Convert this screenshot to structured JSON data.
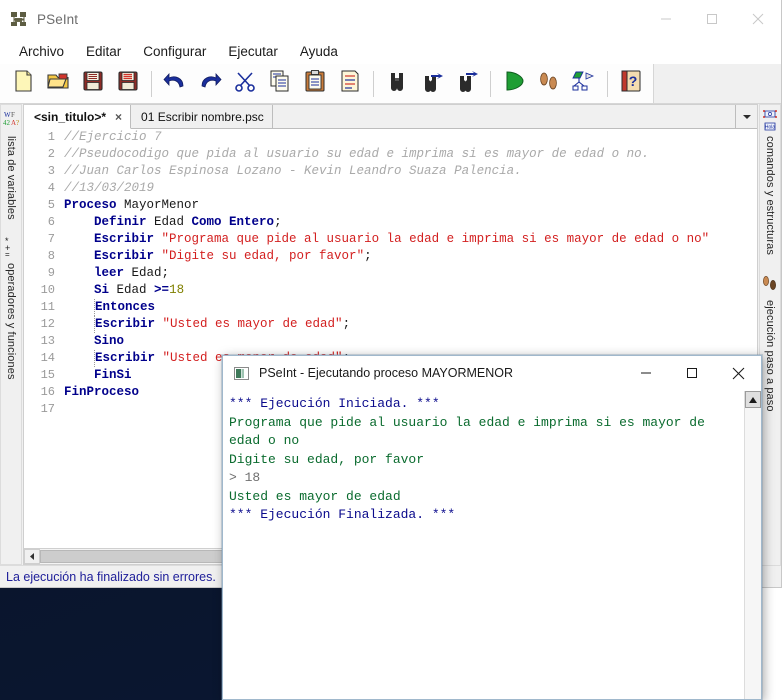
{
  "window": {
    "title": "PSeInt",
    "app_icon": "pseint-logo-icon",
    "controls": {
      "minimize": "minimize-icon",
      "maximize": "maximize-icon",
      "close": "close-icon"
    }
  },
  "menubar": {
    "items": [
      {
        "label": "Archivo"
      },
      {
        "label": "Editar"
      },
      {
        "label": "Configurar"
      },
      {
        "label": "Ejecutar"
      },
      {
        "label": "Ayuda"
      }
    ]
  },
  "toolbar": {
    "buttons": [
      {
        "name": "new-file-button",
        "icon": "new-document-icon",
        "title": "Nuevo"
      },
      {
        "name": "open-file-button",
        "icon": "open-folder-icon",
        "title": "Abrir"
      },
      {
        "name": "save-file-button",
        "icon": "save-diskette-icon",
        "title": "Guardar"
      },
      {
        "name": "save-as-button",
        "icon": "save-as-diskette-icon",
        "title": "Guardar como"
      },
      {
        "name": "undo-button",
        "icon": "undo-arrow-icon",
        "title": "Deshacer"
      },
      {
        "name": "redo-button",
        "icon": "redo-arrow-icon",
        "title": "Rehacer"
      },
      {
        "name": "cut-button",
        "icon": "scissors-icon",
        "title": "Cortar"
      },
      {
        "name": "copy-button",
        "icon": "copy-pages-icon",
        "title": "Copiar"
      },
      {
        "name": "paste-button",
        "icon": "clipboard-paste-icon",
        "title": "Pegar"
      },
      {
        "name": "select-all-button",
        "icon": "document-lines-icon",
        "title": "Seleccionar todo"
      },
      {
        "name": "find-button",
        "icon": "binoculars-icon",
        "title": "Buscar"
      },
      {
        "name": "find-next-button",
        "icon": "binoculars-next-icon",
        "title": "Buscar siguiente"
      },
      {
        "name": "replace-button",
        "icon": "binoculars-replace-icon",
        "title": "Reemplazar"
      },
      {
        "name": "run-button",
        "icon": "green-play-icon",
        "title": "Ejecutar"
      },
      {
        "name": "step-run-button",
        "icon": "footsteps-icon",
        "title": "Ejecución paso a paso"
      },
      {
        "name": "flowchart-button",
        "icon": "flowchart-icon",
        "title": "Dibujar diagrama de flujo"
      },
      {
        "name": "help-button",
        "icon": "help-book-icon",
        "title": "Ayuda"
      }
    ]
  },
  "rails": {
    "left": [
      {
        "label": "lista de variables",
        "icon": "variables-list-icon"
      },
      {
        "label": "operadores y funciones",
        "icon": "operators-functions-icon"
      }
    ],
    "right": [
      {
        "label": "comandos y estructuras",
        "icon": "commands-structures-icon"
      },
      {
        "label": "ejecución paso a paso",
        "icon": "step-execution-icon"
      }
    ]
  },
  "tabs": {
    "items": [
      {
        "label": "<sin_titulo>*",
        "active": true,
        "closable": true
      },
      {
        "label": "01 Escribir nombre.psc",
        "active": false,
        "closable": false
      }
    ],
    "close_glyph": "×",
    "dropdown_icon": "chevron-down-icon"
  },
  "editor": {
    "lines": [
      {
        "n": "1",
        "tokens": [
          {
            "t": "//Ejercicio 7",
            "c": "cmt"
          }
        ]
      },
      {
        "n": "2",
        "tokens": [
          {
            "t": "//Pseudocodigo que pida al usuario su edad e imprima si es mayor de edad o no.",
            "c": "cmt"
          }
        ]
      },
      {
        "n": "3",
        "tokens": [
          {
            "t": "//Juan Carlos Espinosa Lozano - Kevin Leandro Suaza Palencia.",
            "c": "cmt"
          }
        ]
      },
      {
        "n": "4",
        "tokens": [
          {
            "t": "//13/03/2019",
            "c": "cmt"
          }
        ]
      },
      {
        "n": "5",
        "tokens": [
          {
            "t": "Proceso ",
            "c": "kw"
          },
          {
            "t": "MayorMenor",
            "c": "id"
          }
        ]
      },
      {
        "n": "6",
        "tokens": [
          {
            "t": "    ",
            "c": "id"
          },
          {
            "t": "Definir ",
            "c": "kw"
          },
          {
            "t": "Edad ",
            "c": "id"
          },
          {
            "t": "Como Entero",
            "c": "kw"
          },
          {
            "t": ";",
            "c": "id"
          }
        ]
      },
      {
        "n": "7",
        "tokens": [
          {
            "t": "    ",
            "c": "id"
          },
          {
            "t": "Escribir ",
            "c": "kw"
          },
          {
            "t": "\"Programa que pide al usuario la edad e imprima si es mayor de edad o no\"",
            "c": "str"
          }
        ]
      },
      {
        "n": "8",
        "tokens": [
          {
            "t": "    ",
            "c": "id"
          },
          {
            "t": "Escribir ",
            "c": "kw"
          },
          {
            "t": "\"Digite su edad, por favor\"",
            "c": "str"
          },
          {
            "t": ";",
            "c": "id"
          }
        ]
      },
      {
        "n": "9",
        "tokens": [
          {
            "t": "    ",
            "c": "id"
          },
          {
            "t": "leer ",
            "c": "kw"
          },
          {
            "t": "Edad;",
            "c": "id"
          }
        ]
      },
      {
        "n": "10",
        "tokens": [
          {
            "t": "    ",
            "c": "id"
          },
          {
            "t": "Si ",
            "c": "kw"
          },
          {
            "t": "Edad ",
            "c": "id"
          },
          {
            "t": ">=",
            "c": "op"
          },
          {
            "t": "18",
            "c": "num"
          }
        ]
      },
      {
        "n": "11",
        "tokens": [
          {
            "t": "        ",
            "c": "id"
          },
          {
            "t": "Entonces",
            "c": "kw"
          }
        ],
        "guide": true
      },
      {
        "n": "12",
        "tokens": [
          {
            "t": "        ",
            "c": "id"
          },
          {
            "t": "Escribir ",
            "c": "kw"
          },
          {
            "t": "\"Usted es mayor de edad\"",
            "c": "str"
          },
          {
            "t": ";",
            "c": "id"
          }
        ],
        "guide": true
      },
      {
        "n": "13",
        "tokens": [
          {
            "t": "    ",
            "c": "id"
          },
          {
            "t": "Sino",
            "c": "kw"
          }
        ]
      },
      {
        "n": "14",
        "tokens": [
          {
            "t": "        ",
            "c": "id"
          },
          {
            "t": "Escribir ",
            "c": "kw"
          },
          {
            "t": "\"Usted es menor de edad\"",
            "c": "str"
          },
          {
            "t": ";",
            "c": "id"
          }
        ],
        "guide": true
      },
      {
        "n": "15",
        "tokens": [
          {
            "t": "    ",
            "c": "id"
          },
          {
            "t": "FinSi",
            "c": "kw"
          }
        ]
      },
      {
        "n": "16",
        "tokens": [
          {
            "t": "FinProceso",
            "c": "kw"
          }
        ]
      },
      {
        "n": "17",
        "tokens": [
          {
            "t": "",
            "c": "id"
          }
        ]
      }
    ]
  },
  "statusbar": {
    "message": "La ejecución ha finalizado sin errores.",
    "color": "#20209a"
  },
  "console": {
    "title": "PSeInt - Ejecutando proceso MAYORMENOR",
    "icon": "console-window-icon",
    "controls": {
      "minimize": "minimize-icon",
      "maximize": "maximize-icon",
      "close": "close-icon"
    },
    "lines": [
      {
        "text": "*** Ejecución Iniciada. ***",
        "c": "c-sys"
      },
      {
        "text": "Programa que pide al usuario la edad e imprima si es mayor de edad o no",
        "c": "c-out"
      },
      {
        "text": "Digite su edad, por favor",
        "c": "c-out"
      },
      {
        "text": "> 18",
        "c": "c-in"
      },
      {
        "text": "Usted es mayor de edad",
        "c": "c-out"
      },
      {
        "text": "*** Ejecución Finalizada. ***",
        "c": "c-sys"
      }
    ],
    "scroll_up_icon": "scroll-up-arrow-icon"
  },
  "colors": {
    "keyword": "#00008b",
    "string": "#d32020",
    "comment": "#a9a9a9",
    "number": "#808000",
    "console_system": "#0a0a8c",
    "console_output": "#0a6b2e",
    "desktop": "#0d1b38"
  }
}
